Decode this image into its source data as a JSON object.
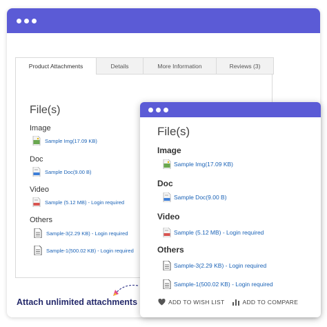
{
  "tabs": [
    {
      "label": "Product Attachments"
    },
    {
      "label": "Details"
    },
    {
      "label": "More Information"
    },
    {
      "label": "Reviews (3)"
    }
  ],
  "back": {
    "title": "File(s)",
    "categories": {
      "image": "Image",
      "doc": "Doc",
      "video": "Video",
      "others": "Others"
    },
    "files": {
      "img": "Sample Img(17.09 KB)",
      "doc": "Sample Doc(9.00 B)",
      "video": "Sample (5.12 MB) - Login required",
      "other1": "Sample-3(2.29 KB) - Login required",
      "other2": "Sample-1(500.02 KB) - Login required"
    }
  },
  "front": {
    "title": "File(s)",
    "categories": {
      "image": "Image",
      "doc": "Doc",
      "video": "Video",
      "others": "Others"
    },
    "files": {
      "img": "Sample Img(17.09 KB)",
      "doc": "Sample Doc(9.00 B)",
      "video": "Sample (5.12 MB) - Login required",
      "other1": "Sample-3(2.29 KB) - Login required",
      "other2": "Sample-1(500.02 KB) - Login required"
    },
    "actions": {
      "wishlist": "ADD TO WISH LIST",
      "compare": "ADD TO COMPARE"
    }
  },
  "caption": "Attach unlimited attachments",
  "icons": {
    "image_file": "image-file-icon",
    "doc_file": "doc-file-icon",
    "video_file": "video-file-icon",
    "generic_file": "document-icon",
    "heart": "heart-icon",
    "compare": "bar-chart-icon"
  },
  "colors": {
    "titlebar": "#5b5bd6",
    "link": "#1a62b6",
    "caption": "#252a6b"
  }
}
